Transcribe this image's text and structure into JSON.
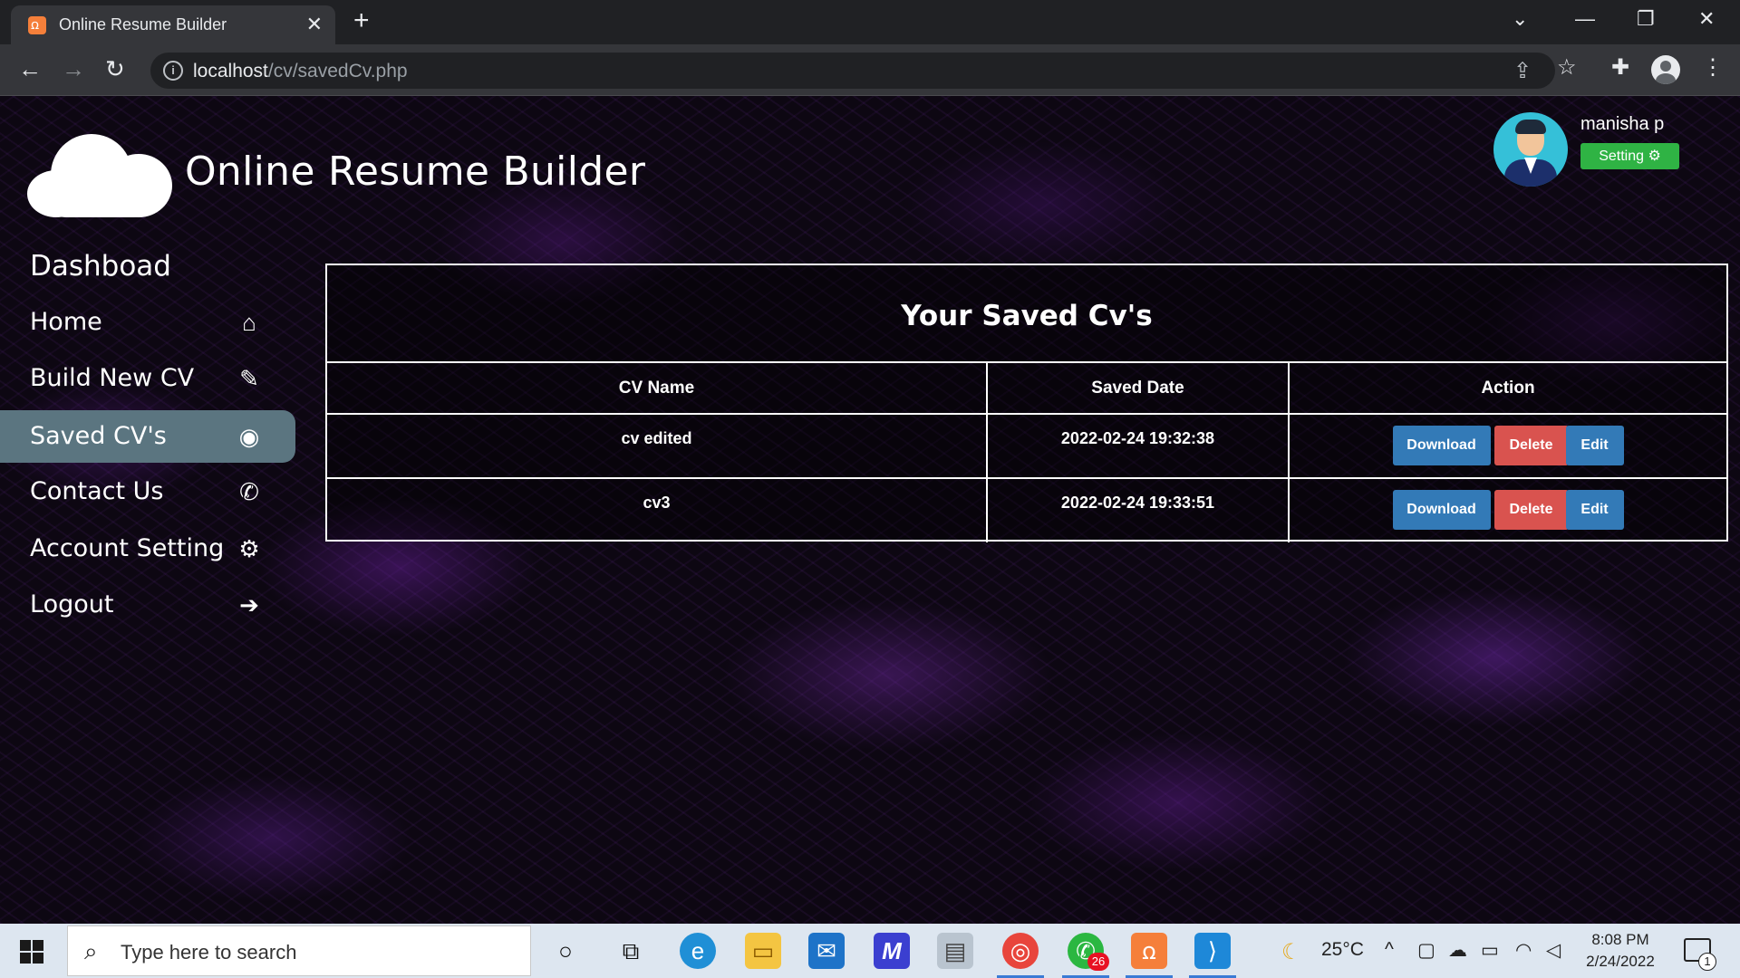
{
  "browser": {
    "tab_title": "Online Resume Builder",
    "tab_close": "✕",
    "new_tab": "+",
    "url_host": "localhost",
    "url_path": "/cv/savedCv.php"
  },
  "header": {
    "site_title": "Online Resume Builder",
    "user_name": "manisha p",
    "setting_label": "Setting ⚙"
  },
  "sidebar": {
    "title": "Dashboad",
    "items": [
      {
        "label": "Home",
        "icon": "⌂",
        "icon_name": "home-icon"
      },
      {
        "label": "Build New CV",
        "icon": "✎",
        "icon_name": "edit-icon"
      },
      {
        "label": "Saved CV's",
        "icon": "◉",
        "icon_name": "user-circle-icon"
      },
      {
        "label": "Contact Us",
        "icon": "✆",
        "icon_name": "phone-icon"
      },
      {
        "label": "Account Setting",
        "icon": "⚙",
        "icon_name": "gear-icon"
      },
      {
        "label": "Logout",
        "icon": "➔",
        "icon_name": "logout-icon"
      }
    ],
    "active_index": 2
  },
  "saved_cvs": {
    "title": "Your Saved Cv's",
    "columns": [
      "CV Name",
      "Saved Date",
      "Action"
    ],
    "rows": [
      {
        "name": "cv edited",
        "date": "2022-02-24 19:32:38"
      },
      {
        "name": "cv3",
        "date": "2022-02-24 19:33:51"
      }
    ],
    "actions": {
      "download": "Download",
      "delete": "Delete",
      "edit": "Edit"
    }
  },
  "taskbar": {
    "search_placeholder": "Type here to search",
    "whatsapp_badge": "26",
    "weather": "25°C",
    "time": "8:08 PM",
    "date": "2/24/2022",
    "notification_count": "1"
  },
  "colors": {
    "download": "#337ab7",
    "delete": "#d9534f",
    "edit": "#337ab7",
    "setting": "#2fb344",
    "active_item": "#5b7580"
  }
}
